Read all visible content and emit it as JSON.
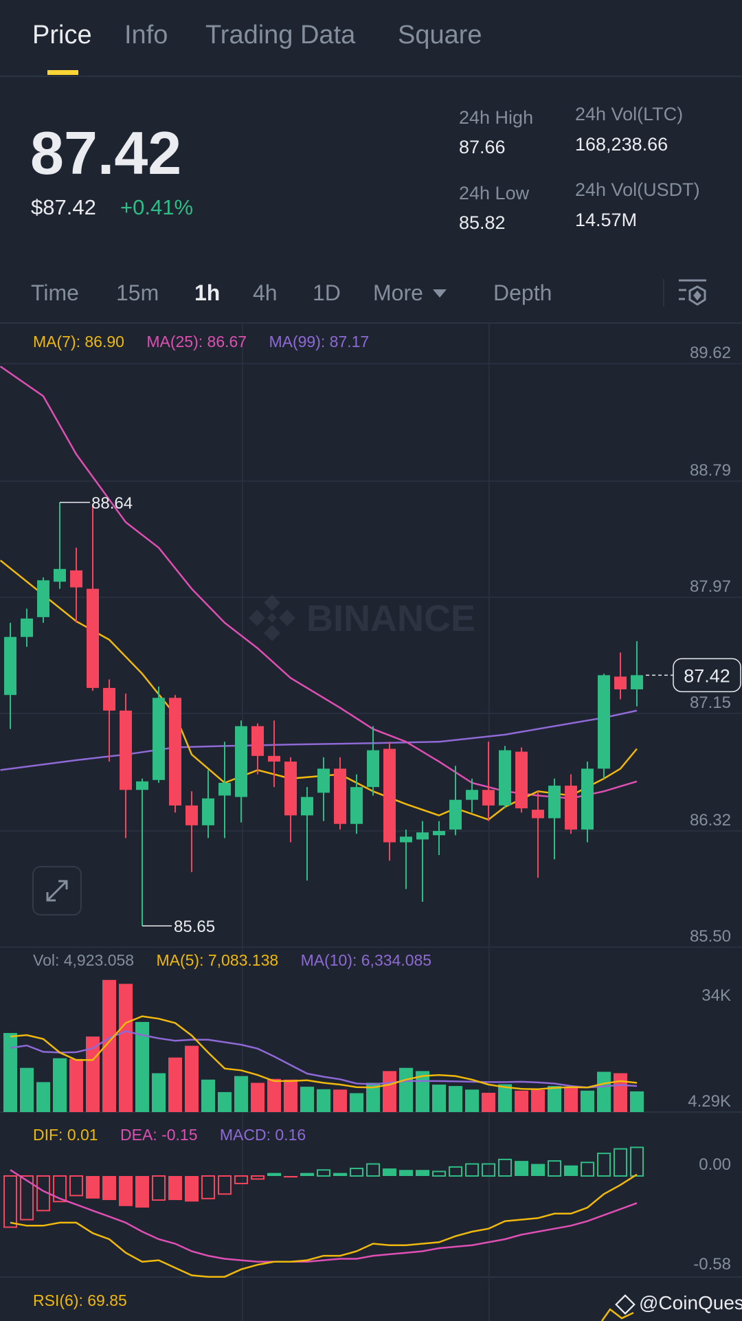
{
  "tabs": [
    {
      "label": "Price",
      "active": true
    },
    {
      "label": "Info"
    },
    {
      "label": "Trading Data"
    },
    {
      "label": "Square"
    }
  ],
  "ticker": {
    "last_price": "87.42",
    "usd_price": "$87.42",
    "change_pct": "+0.41%",
    "high_label": "24h High",
    "high_value": "87.66",
    "low_label": "24h Low",
    "low_value": "85.82",
    "vol_base_label": "24h Vol(LTC)",
    "vol_base_value": "168,238.66",
    "vol_quote_label": "24h Vol(USDT)",
    "vol_quote_value": "14.57M"
  },
  "intervals": {
    "items": [
      "Time",
      "15m",
      "1h",
      "4h",
      "1D",
      "More"
    ],
    "active": "1h",
    "depth": "Depth"
  },
  "colors": {
    "up": "#2ebd85",
    "down": "#f6465d",
    "ma7": "#f0b90b",
    "ma25": "#e04fb4",
    "ma99": "#8f6ad6",
    "accent": "#fcd535"
  },
  "price_legend": {
    "ma7": "MA(7): 86.90",
    "ma25": "MA(25): 86.67",
    "ma99": "MA(99): 87.17"
  },
  "vol_legend": {
    "vol": "Vol: 4,923.058",
    "ma5": "MA(5): 7,083.138",
    "ma10": "MA(10): 6,334.085"
  },
  "macd_legend": {
    "dif": "DIF: 0.01",
    "dea": "DEA: -0.15",
    "macd": "MACD: 0.16"
  },
  "rsi_legend": "RSI(6): 69.85",
  "watermark": "BINANCE",
  "credit": "@CoinQuest",
  "chart_data": {
    "type": "candlestick",
    "price_axis": {
      "ticks": [
        "89.62",
        "88.79",
        "87.97",
        "87.15",
        "86.32",
        "85.50"
      ],
      "range": [
        85.5,
        89.62
      ]
    },
    "current_price": "87.42",
    "high_marker": {
      "index": 3,
      "label": "88.64"
    },
    "low_marker": {
      "index": 8,
      "label": "85.65"
    },
    "candles": [
      [
        87.28,
        87.79,
        87.04,
        87.69
      ],
      [
        87.69,
        87.89,
        87.62,
        87.82
      ],
      [
        87.83,
        88.11,
        87.79,
        88.09
      ],
      [
        88.08,
        88.64,
        88.03,
        88.17
      ],
      [
        88.16,
        88.32,
        87.79,
        88.04
      ],
      [
        88.03,
        88.62,
        87.31,
        87.33
      ],
      [
        87.33,
        87.39,
        86.81,
        87.17
      ],
      [
        87.17,
        87.29,
        86.27,
        86.61
      ],
      [
        86.61,
        86.69,
        85.65,
        86.67
      ],
      [
        86.68,
        87.34,
        86.66,
        87.26
      ],
      [
        87.26,
        87.28,
        86.45,
        86.5
      ],
      [
        86.5,
        86.6,
        86.03,
        86.36
      ],
      [
        86.36,
        86.75,
        86.27,
        86.55
      ],
      [
        86.57,
        86.95,
        86.27,
        86.66
      ],
      [
        86.56,
        87.1,
        86.38,
        87.06
      ],
      [
        87.06,
        87.08,
        86.72,
        86.85
      ],
      [
        86.85,
        87.1,
        86.63,
        86.81
      ],
      [
        86.81,
        86.84,
        86.24,
        86.43
      ],
      [
        86.43,
        86.63,
        85.97,
        86.56
      ],
      [
        86.59,
        86.84,
        86.39,
        86.76
      ],
      [
        86.76,
        86.84,
        86.33,
        86.37
      ],
      [
        86.37,
        86.72,
        86.3,
        86.63
      ],
      [
        86.63,
        87.06,
        86.57,
        86.89
      ],
      [
        86.9,
        86.95,
        86.11,
        86.24
      ],
      [
        86.24,
        86.33,
        85.91,
        86.28
      ],
      [
        86.26,
        86.39,
        85.82,
        86.31
      ],
      [
        86.29,
        86.39,
        86.15,
        86.32
      ],
      [
        86.33,
        86.78,
        86.29,
        86.54
      ],
      [
        86.54,
        86.69,
        86.45,
        86.61
      ],
      [
        86.61,
        86.95,
        86.39,
        86.5
      ],
      [
        86.5,
        86.92,
        86.48,
        86.89
      ],
      [
        86.88,
        86.91,
        86.45,
        86.48
      ],
      [
        86.47,
        86.6,
        85.99,
        86.41
      ],
      [
        86.41,
        86.69,
        86.12,
        86.64
      ],
      [
        86.64,
        86.72,
        86.3,
        86.33
      ],
      [
        86.33,
        86.81,
        86.24,
        86.76
      ],
      [
        86.76,
        87.43,
        86.69,
        87.42
      ],
      [
        87.41,
        87.58,
        87.25,
        87.32
      ],
      [
        87.32,
        87.66,
        87.2,
        87.42
      ]
    ],
    "ma7": [
      [
        -0.6,
        88.23
      ],
      [
        4,
        87.8
      ],
      [
        6,
        87.67
      ],
      [
        8,
        87.43
      ],
      [
        10,
        87.14
      ],
      [
        11,
        86.86
      ],
      [
        13,
        86.66
      ],
      [
        15,
        86.75
      ],
      [
        17,
        86.69
      ],
      [
        20,
        86.72
      ],
      [
        22,
        86.6
      ],
      [
        24,
        86.51
      ],
      [
        26,
        86.43
      ],
      [
        27,
        86.48
      ],
      [
        29,
        86.4
      ],
      [
        30,
        86.49
      ],
      [
        32,
        86.6
      ],
      [
        34,
        86.57
      ],
      [
        35,
        86.63
      ],
      [
        36,
        86.69
      ],
      [
        37,
        86.76
      ],
      [
        38,
        86.9
      ]
    ],
    "ma25": [
      [
        -0.6,
        89.6
      ],
      [
        2,
        89.39
      ],
      [
        4,
        88.98
      ],
      [
        7,
        88.5
      ],
      [
        9,
        88.32
      ],
      [
        11,
        88.03
      ],
      [
        13,
        87.79
      ],
      [
        15,
        87.61
      ],
      [
        17,
        87.4
      ],
      [
        20,
        87.19
      ],
      [
        22,
        87.04
      ],
      [
        24,
        86.95
      ],
      [
        26,
        86.81
      ],
      [
        28,
        86.66
      ],
      [
        30,
        86.6
      ],
      [
        32,
        86.57
      ],
      [
        34,
        86.55
      ],
      [
        36,
        86.6
      ],
      [
        38,
        86.67
      ]
    ],
    "ma99": [
      [
        -0.6,
        86.75
      ],
      [
        4,
        86.82
      ],
      [
        7,
        86.86
      ],
      [
        10,
        86.91
      ],
      [
        13,
        86.92
      ],
      [
        17,
        86.93
      ],
      [
        22,
        86.94
      ],
      [
        26,
        86.95
      ],
      [
        30,
        87.0
      ],
      [
        33,
        87.06
      ],
      [
        36,
        87.12
      ],
      [
        38,
        87.17
      ]
    ],
    "volume_axis": {
      "ticks": [
        "34K",
        "4.29K"
      ]
    },
    "volume_k": [
      22.6,
      12.8,
      8.8,
      15.5,
      15.3,
      21.6,
      37.5,
      36.4,
      25.7,
      11.3,
      15.7,
      19.0,
      9.5,
      6.0,
      10.5,
      8.6,
      9.7,
      9.5,
      7.5,
      6.8,
      6.7,
      5.7,
      8.6,
      11.9,
      12.8,
      11.9,
      8.1,
      7.7,
      6.7,
      5.8,
      8.2,
      6.4,
      6.6,
      7.7,
      7.5,
      6.4,
      11.7,
      11.3,
      6.2
    ],
    "volume_ma5_k": [
      21.6,
      22.0,
      20.9,
      17.1,
      15.0,
      15.0,
      20.2,
      25.4,
      27.3,
      26.6,
      25.4,
      21.9,
      17.1,
      12.6,
      12.1,
      10.8,
      9.1,
      9.1,
      9.3,
      8.6,
      8.1,
      7.4,
      7.3,
      8.1,
      9.5,
      10.5,
      10.8,
      10.5,
      9.5,
      8.1,
      7.4,
      6.9,
      6.8,
      7.2,
      7.4,
      7.3,
      8.4,
      9.1,
      8.6
    ],
    "volume_ma10_k": [
      18.4,
      19.1,
      17.3,
      17.1,
      17.2,
      18.3,
      21.2,
      23.1,
      22.0,
      21.1,
      20.4,
      20.7,
      20.7,
      20.0,
      19.3,
      18.2,
      16.0,
      13.6,
      11.2,
      10.3,
      9.6,
      8.4,
      8.2,
      8.6,
      9.1,
      9.1,
      9.1,
      9.0,
      8.9,
      8.8,
      8.8,
      8.9,
      8.7,
      8.4,
      7.7,
      7.3,
      7.6,
      8.0,
      7.7
    ],
    "macd_axis": {
      "ticks": [
        "0.00",
        "-0.58"
      ]
    },
    "macd_hist": [
      -0.34,
      -0.29,
      -0.23,
      -0.17,
      -0.13,
      -0.15,
      -0.16,
      -0.2,
      -0.21,
      -0.16,
      -0.16,
      -0.17,
      -0.15,
      -0.12,
      -0.05,
      -0.02,
      0.02,
      -0.01,
      0.02,
      0.04,
      0.02,
      0.05,
      0.08,
      0.05,
      0.04,
      0.04,
      0.03,
      0.06,
      0.08,
      0.08,
      0.11,
      0.1,
      0.08,
      0.1,
      0.07,
      0.09,
      0.15,
      0.18,
      0.19
    ],
    "macd_hollow": [
      1,
      1,
      1,
      1,
      1,
      0,
      0,
      0,
      0,
      1,
      0,
      0,
      1,
      1,
      1,
      1,
      0,
      0,
      0,
      1,
      0,
      1,
      1,
      0,
      0,
      0,
      1,
      1,
      1,
      1,
      1,
      0,
      0,
      1,
      0,
      1,
      1,
      1,
      1
    ],
    "dif": [
      -0.31,
      -0.33,
      -0.33,
      -0.31,
      -0.31,
      -0.38,
      -0.42,
      -0.51,
      -0.57,
      -0.56,
      -0.61,
      -0.66,
      -0.67,
      -0.67,
      -0.62,
      -0.59,
      -0.57,
      -0.57,
      -0.56,
      -0.53,
      -0.53,
      -0.5,
      -0.45,
      -0.46,
      -0.46,
      -0.45,
      -0.44,
      -0.4,
      -0.37,
      -0.35,
      -0.3,
      -0.29,
      -0.28,
      -0.25,
      -0.25,
      -0.21,
      -0.12,
      -0.06,
      0.01
    ],
    "dea": [
      0.04,
      -0.03,
      -0.1,
      -0.15,
      -0.19,
      -0.23,
      -0.27,
      -0.31,
      -0.37,
      -0.42,
      -0.45,
      -0.5,
      -0.53,
      -0.55,
      -0.56,
      -0.57,
      -0.57,
      -0.57,
      -0.57,
      -0.56,
      -0.55,
      -0.55,
      -0.53,
      -0.52,
      -0.51,
      -0.5,
      -0.48,
      -0.47,
      -0.46,
      -0.44,
      -0.42,
      -0.39,
      -0.37,
      -0.35,
      -0.33,
      -0.3,
      -0.26,
      -0.22,
      -0.18
    ]
  }
}
